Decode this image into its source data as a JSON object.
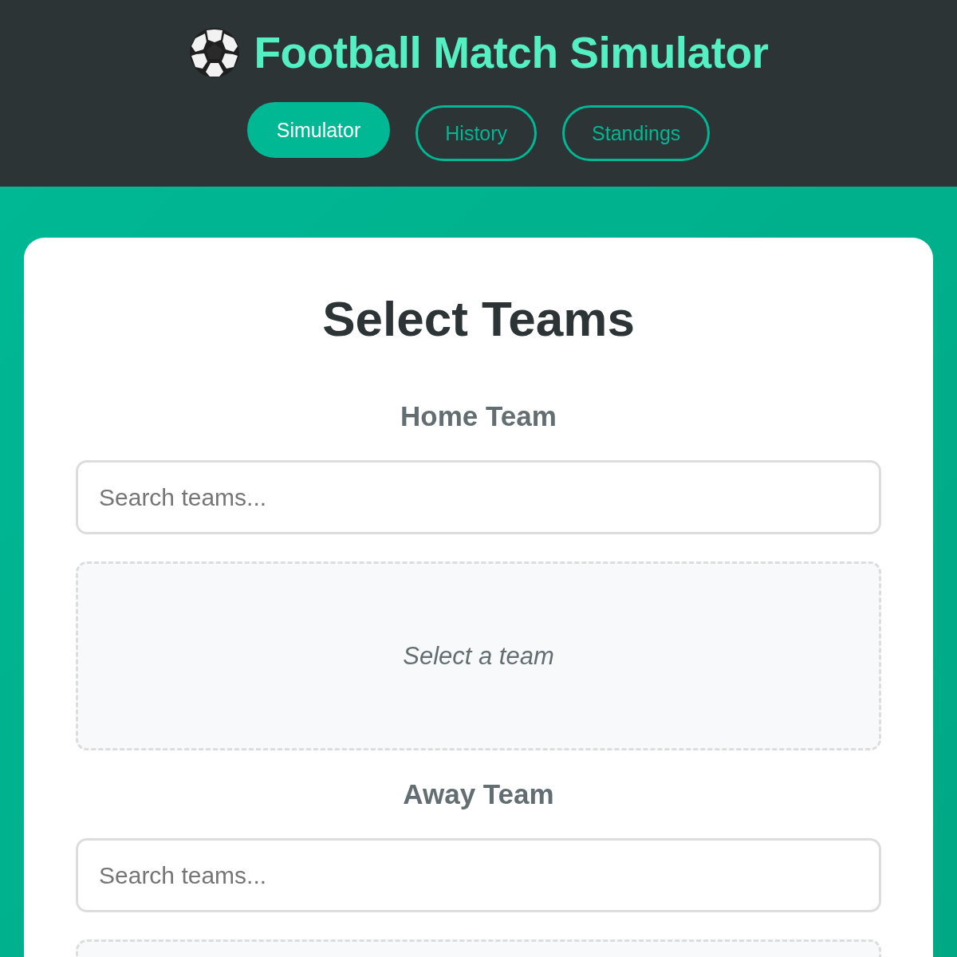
{
  "header": {
    "title": "Football Match Simulator",
    "nav": [
      {
        "label": "Simulator",
        "selected": true
      },
      {
        "label": "History",
        "selected": false
      },
      {
        "label": "Standings",
        "selected": false
      }
    ]
  },
  "panel": {
    "title": "Select Teams",
    "teams": [
      {
        "label": "Home Team",
        "placeholder": "Search teams...",
        "empty_text": "Select a team"
      },
      {
        "label": "Away Team",
        "placeholder": "Search teams..."
      }
    ]
  }
}
